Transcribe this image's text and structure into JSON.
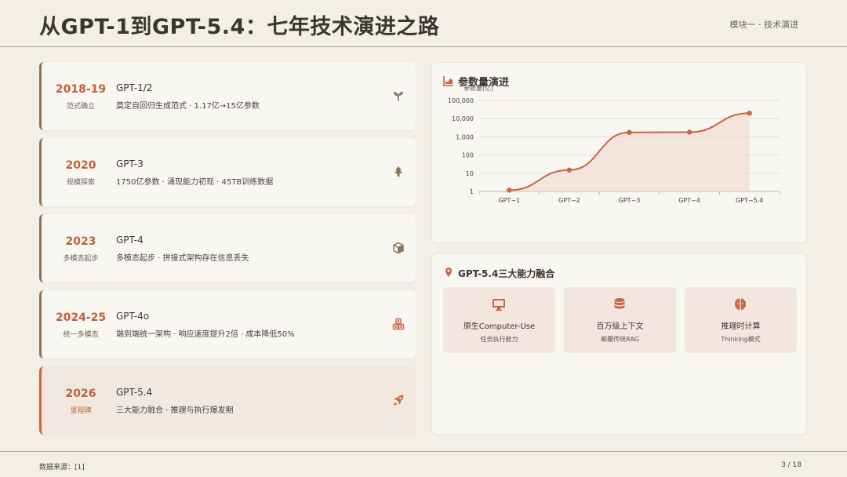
{
  "header": {
    "title": "从GPT-1到GPT-5.4：七年技术演进之路",
    "module": "模块一 · 技术演进"
  },
  "timeline": [
    {
      "year": "2018-19",
      "sub": "范式确立",
      "name": "GPT-1/2",
      "desc": "奠定自回归生成范式 · 1.17亿→15亿参数",
      "icon": "seedling-icon"
    },
    {
      "year": "2020",
      "sub": "规模探索",
      "name": "GPT-3",
      "desc": "1750亿参数 · 涌现能力初现 · 45TB训练数据",
      "icon": "tree-icon"
    },
    {
      "year": "2023",
      "sub": "多模态起步",
      "name": "GPT-4",
      "desc": "多模态起步 · 拼接式架构存在信息丢失",
      "icon": "cube-icon"
    },
    {
      "year": "2024-25",
      "sub": "统一多模态",
      "name": "GPT-4o",
      "desc": "端到端统一架构 · 响应速度提升2倍 · 成本降低50%",
      "icon": "cubes-icon"
    },
    {
      "year": "2026",
      "sub": "里程碑",
      "name": "GPT-5.4",
      "desc": "三大能力融合 · 推理与执行爆发期",
      "icon": "rocket-icon"
    }
  ],
  "chart_panel": {
    "title": "参数量演进",
    "icon": "area-chart-icon"
  },
  "chart_data": {
    "type": "area",
    "title": "参数量演进",
    "ylabel": "参数量(亿)",
    "xlabel": "",
    "yscale": "log",
    "categories": [
      "GPT−1",
      "GPT−2",
      "GPT−3",
      "GPT−4",
      "GPT−5.4"
    ],
    "values": [
      1.17,
      15,
      1750,
      1800,
      20000
    ],
    "ylim": [
      1,
      100000
    ],
    "yticks": [
      "1",
      "10",
      "100",
      "1,000",
      "10,000",
      "100,000"
    ],
    "grid": true,
    "colors": {
      "line": "#c96444",
      "fill": "#f1dcd3"
    }
  },
  "capability_panel": {
    "title": "GPT-5.4三大能力融合",
    "icon": "map-pin-icon",
    "items": [
      {
        "title": "原生Computer-Use",
        "sub": "任务执行能力",
        "icon": "monitor-icon"
      },
      {
        "title": "百万级上下文",
        "sub": "颠覆传统RAG",
        "icon": "database-icon"
      },
      {
        "title": "推理时计算",
        "sub": "Thinking模式",
        "icon": "brain-icon"
      }
    ]
  },
  "footer": {
    "source": "数据来源：[1]",
    "page": "3 / 18"
  },
  "colors": {
    "accent": "#c96444",
    "background": "#f3efe6",
    "card": "#f9f7f2",
    "timeline_border": "#8b7357"
  }
}
